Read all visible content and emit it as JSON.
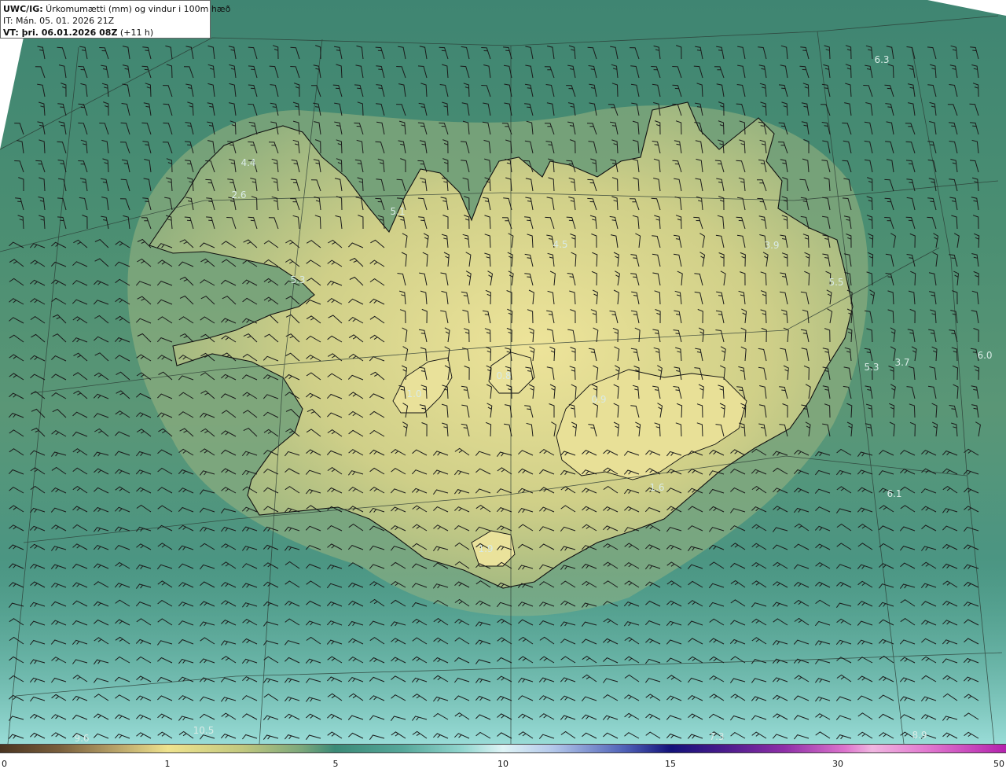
{
  "header": {
    "model_code": "UWC/IG:",
    "description": " Úrkomumætti (mm) og vindur i 100m hæð",
    "init_time": "IT: Mán. 05. 01. 2026 21Z",
    "valid_prefix": "VT: ",
    "valid_time": "þri. 06.01.2026 08Z",
    "lead_time": " (+11 h)"
  },
  "map_values": [
    {
      "value": "6.3"
    },
    {
      "value": "4.4"
    },
    {
      "value": "2.6"
    },
    {
      "value": "5.1"
    },
    {
      "value": "4.5"
    },
    {
      "value": "5.3"
    },
    {
      "value": "3.9"
    },
    {
      "value": "5.5"
    },
    {
      "value": "5.3"
    },
    {
      "value": "3.7"
    },
    {
      "value": "6.0"
    },
    {
      "value": "1.0"
    },
    {
      "value": "0.8"
    },
    {
      "value": "0.9"
    },
    {
      "value": "6.1"
    },
    {
      "value": "1.6"
    },
    {
      "value": "1.9"
    },
    {
      "value": "9.6"
    },
    {
      "value": "10.5"
    },
    {
      "value": "7.3"
    },
    {
      "value": "8.9"
    }
  ],
  "colorbar": {
    "ticks": [
      "0",
      "1",
      "5",
      "10",
      "15",
      "30",
      "50"
    ]
  },
  "colors": {
    "land_light": "#e6e08f",
    "sea_dark": "#2f7a68",
    "sea_light": "#8fd6d2",
    "coastline": "#111111"
  },
  "icons": {
    "wind_barbs": "wind-barb-icon"
  }
}
